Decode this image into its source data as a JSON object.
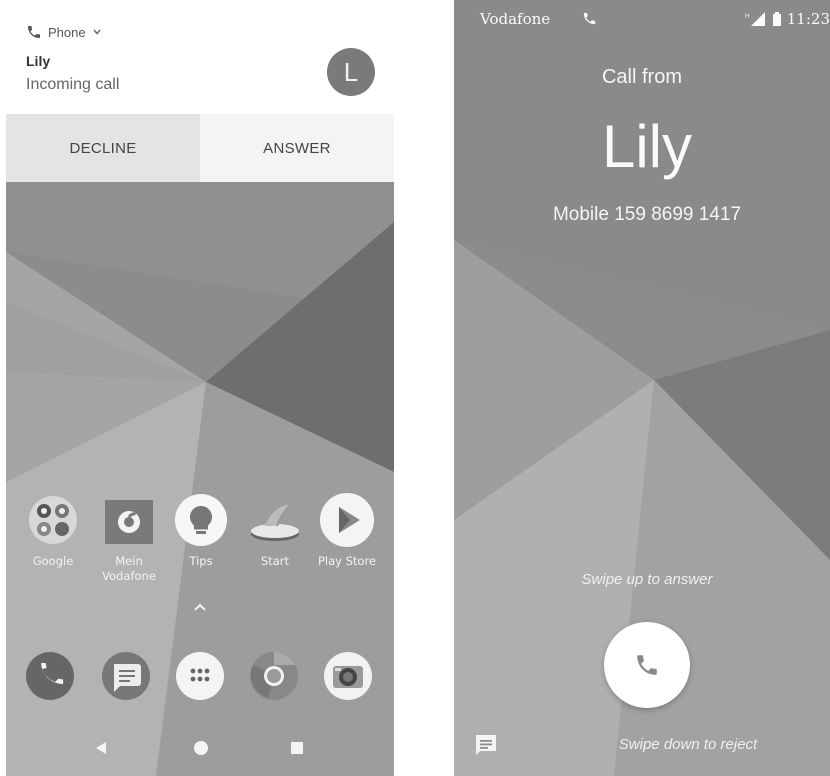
{
  "left_screen": {
    "notification": {
      "app_name": "Phone",
      "caller": "Lily",
      "status": "Incoming call",
      "avatar_letter": "L",
      "decline_label": "DECLINE",
      "answer_label": "ANSWER"
    },
    "home_apps": [
      {
        "label": "Google",
        "icon": "google-folder-icon"
      },
      {
        "label": "Mein Vodafone",
        "icon": "vodafone-icon"
      },
      {
        "label": "Tips",
        "icon": "tips-bulb-icon"
      },
      {
        "label": "Start",
        "icon": "start-icon"
      },
      {
        "label": "Play Store",
        "icon": "play-store-icon"
      }
    ],
    "dock_apps": [
      "phone-icon",
      "messages-icon",
      "app-drawer-icon",
      "chrome-icon",
      "camera-icon"
    ],
    "nav": [
      "back-icon",
      "home-icon",
      "recents-icon"
    ]
  },
  "right_screen": {
    "status_bar": {
      "carrier": "Vodafone",
      "time": "11:23"
    },
    "call_from": "Call from",
    "caller": "Lily",
    "number": "Mobile 159 8699 1417",
    "swipe_up": "Swipe up to answer",
    "swipe_down": "Swipe down to reject"
  }
}
